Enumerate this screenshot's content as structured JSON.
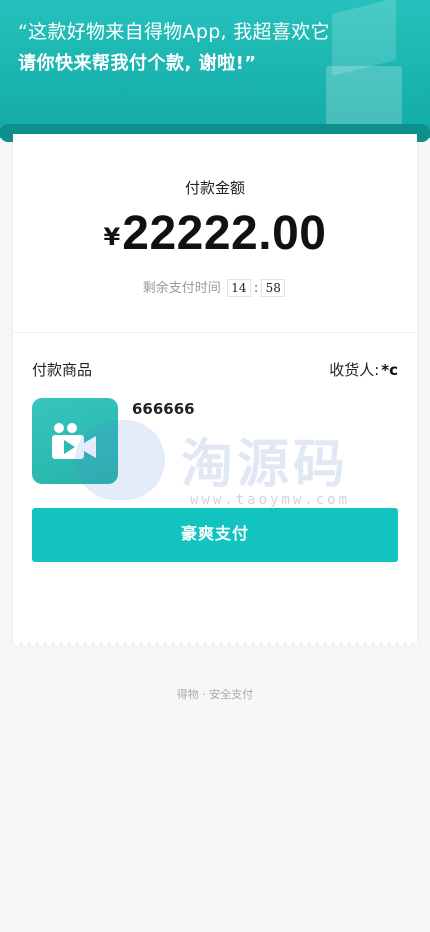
{
  "header": {
    "quote_line1": "“这款好物来自得物App, 我超喜欢它",
    "quote_line2": "请你快来帮我付个款, 谢啦!”",
    "accent_color": "#1bb5b1"
  },
  "payment": {
    "amount_label": "付款金额",
    "currency_symbol": "¥",
    "amount": "22222.00",
    "timer_label": "剩余支付时间",
    "minutes": "14",
    "seconds": "58",
    "timer_separator": ":"
  },
  "goods": {
    "section_label": "付款商品",
    "receiver_label": "收货人:",
    "receiver_value": "*c",
    "item_name": "666666",
    "thumbnail_icon": "video-camera-icon"
  },
  "watermark": {
    "text": "淘源码",
    "url": "www.taoymw.com"
  },
  "actions": {
    "pay_button_label": "豪爽支付",
    "pay_button_color": "#12c3c0"
  },
  "footer": {
    "text": "得物 · 安全支付"
  }
}
